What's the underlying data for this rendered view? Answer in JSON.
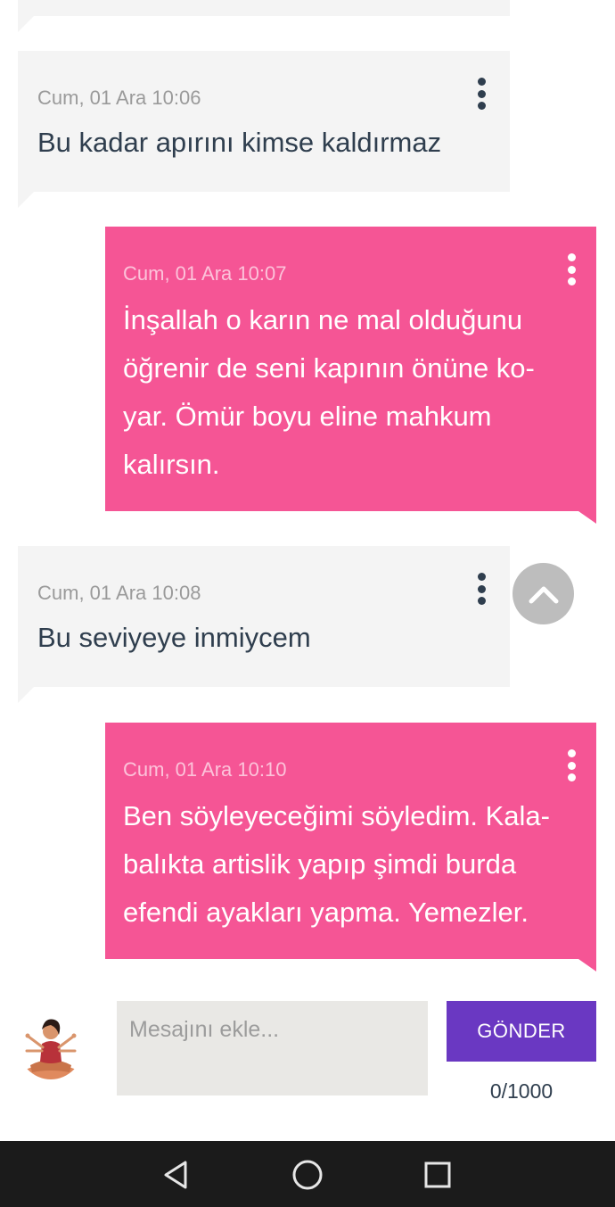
{
  "colors": {
    "incoming_bubble": "#f4f4f4",
    "outgoing_bubble": "#f55595",
    "send_button": "#6a38c2",
    "nav_bar": "#1b1b1b"
  },
  "messages": [
    {
      "direction": "incoming",
      "time": "Cum, 01 Ara 10:06",
      "lines": [
        "Bu kadar apırını kimse kaldırmaz"
      ]
    },
    {
      "direction": "outgoing",
      "time": "Cum, 01 Ara 10:07",
      "lines": [
        "İnşallah o karın ne mal olduğunu",
        "öğrenir de seni kapının önüne ko-",
        "yar. Ömür boyu eline mahkum",
        "kalırsın."
      ]
    },
    {
      "direction": "incoming",
      "time": "Cum, 01 Ara 10:08",
      "lines": [
        "Bu seviyeye inmiycem"
      ]
    },
    {
      "direction": "outgoing",
      "time": "Cum, 01 Ara 10:10",
      "lines": [
        "Ben söyleyeceğimi söyledim. Kala-",
        "balıkta artislik yapıp şimdi burda",
        "efendi ayakları yapma. Yemezler."
      ]
    }
  ],
  "composer": {
    "placeholder": "Mesajını ekle...",
    "value": "",
    "send_label": "GÖNDER",
    "char_counter": "0/1000"
  },
  "icons": {
    "message_menu": "more-vertical-icon",
    "scroll_top": "chevron-up-icon",
    "nav_back": "back-triangle-icon",
    "nav_home": "home-circle-icon",
    "nav_recents": "recents-square-icon"
  }
}
